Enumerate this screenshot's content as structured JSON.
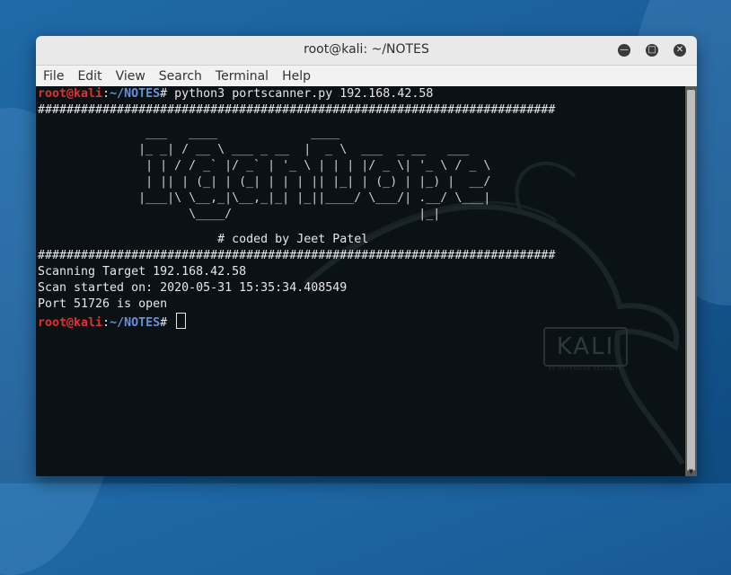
{
  "window": {
    "title": "root@kali: ~/NOTES",
    "controls": [
      "minimize-icon",
      "maximize-icon",
      "close-icon"
    ]
  },
  "menu": [
    "File",
    "Edit",
    "View",
    "Search",
    "Terminal",
    "Help"
  ],
  "terminal": {
    "prompt_user": "root@kali",
    "prompt_sep": ":",
    "prompt_path": "~/NOTES",
    "prompt_symbol": "#",
    "command": " python3 portscanner.py 192.168.42.58",
    "hash_line": "########################################################################",
    "banner": [
      "               ___   ____             ____",
      "              |_ _| / __ \\ ___ _ __  |  _ \\  ___  _ __   ___",
      "               | | / / _` |/ _` | '_ \\ | | | |/ _ \\| '_ \\ / _ \\",
      "               | || | (_| | (_| | | | || |_| | (_) | |_) |  __/",
      "              |___|\\ \\__,_|\\__,_|_| |_||____/ \\___/| .__/ \\___|",
      "                     \\____/                          |_|"
    ],
    "coded_by": "                         # coded by Jeet Patel",
    "output": [
      "Scanning Target 192.168.42.58",
      "Scan started on: 2020-05-31 15:35:34.408549",
      "Port 51726 is open"
    ]
  },
  "background": {
    "logo_text": "KALI",
    "logo_sub": "BY OFFENSIVE SECURITY"
  }
}
